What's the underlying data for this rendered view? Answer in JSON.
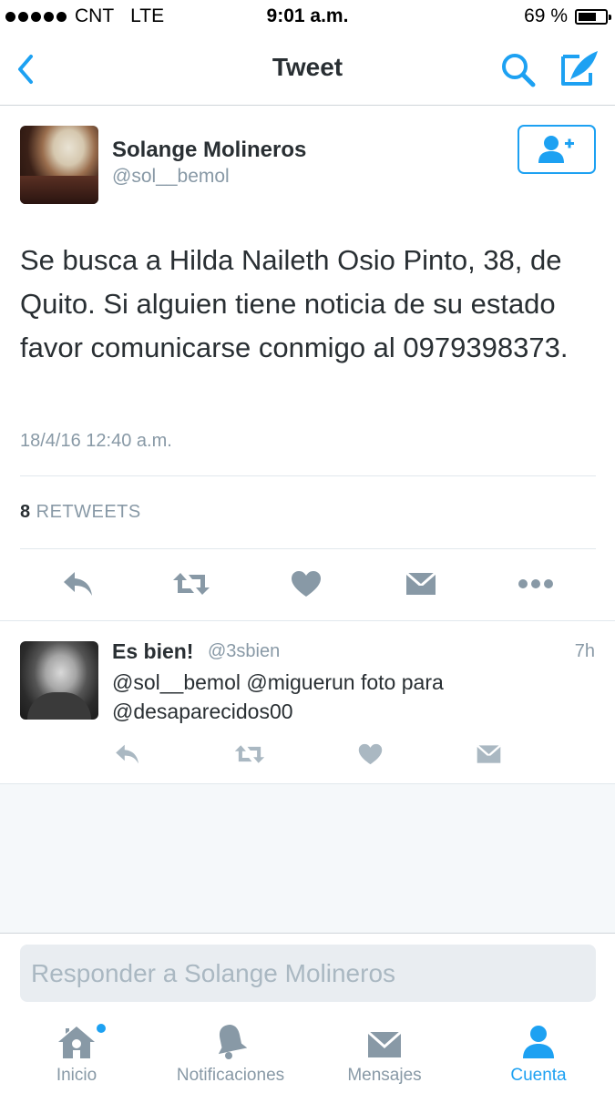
{
  "status_bar": {
    "carrier": "CNT",
    "network": "LTE",
    "time": "9:01 a.m.",
    "battery_text": "69 %",
    "battery_level": 0.69
  },
  "nav": {
    "title": "Tweet",
    "back_icon": "chevron-left-icon",
    "search_icon": "search-icon",
    "compose_icon": "compose-icon"
  },
  "tweet": {
    "author_name": "Solange Molineros",
    "author_handle": "@sol__bemol",
    "text": "Se busca a Hilda Naileth Osio Pinto, 38, de Quito. Si alguien tiene noticia de su estado favor comunicarse conmigo al 0979398373.",
    "timestamp": "18/4/16 12:40 a.m.",
    "retweet_count": "8",
    "retweet_label": "RETWEETS"
  },
  "reply": {
    "author_name": "Es bien!",
    "author_handle": "@3sbien",
    "age": "7h",
    "text": "@sol__bemol @miguerun foto para @desaparecidos00"
  },
  "composer": {
    "placeholder": "Responder a Solange Molineros"
  },
  "tabs": [
    {
      "label": "Inicio",
      "icon": "home-icon"
    },
    {
      "label": "Notificaciones",
      "icon": "bell-icon"
    },
    {
      "label": "Mensajes",
      "icon": "envelope-icon"
    },
    {
      "label": "Cuenta",
      "icon": "person-icon"
    }
  ],
  "colors": {
    "accent": "#1da1f2",
    "muted": "#8899a6",
    "icon_gray": "#8899a6"
  }
}
